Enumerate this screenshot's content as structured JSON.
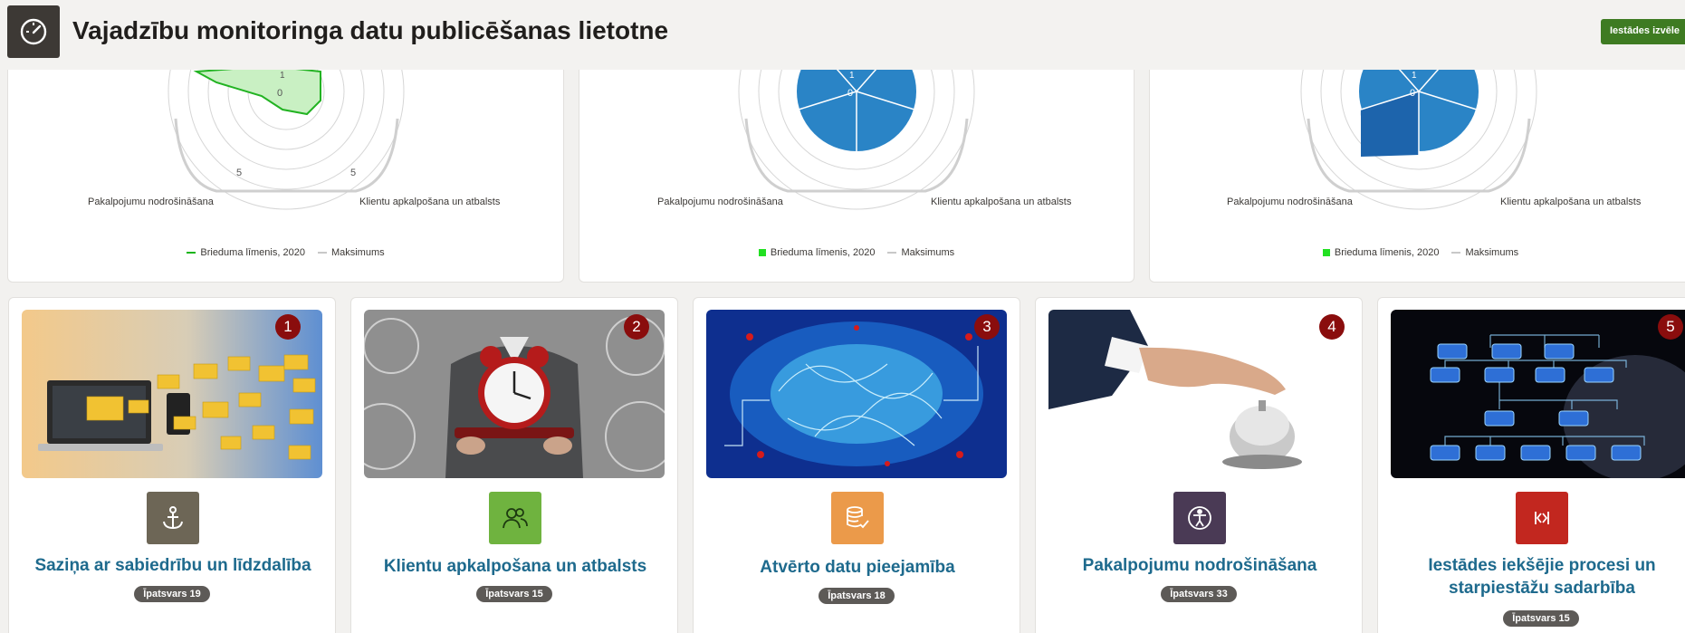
{
  "app": {
    "title": "Vajadzību monitoringa datu publicēšanas lietotne",
    "logo_icon": "dashboard-gauge-icon",
    "institution_button": "Iestādes izvēle"
  },
  "charts": [
    {
      "axis_left_label": "Pakalpojumu nodrošināšana",
      "axis_right_label": "Klientu apkalpošana un atbalsts",
      "tick_labels": [
        "1",
        "0",
        "5",
        "5"
      ],
      "legend": [
        {
          "label": "Brieduma līmenis, 2020",
          "color": "#1cb51c",
          "marker": "line"
        },
        {
          "label": "Maksimums",
          "color": "#c8c8c8",
          "marker": "line"
        }
      ]
    },
    {
      "axis_left_label": "Pakalpojumu nodrošināšana",
      "axis_right_label": "Klientu apkalpošana un atbalsts",
      "tick_labels": [
        "1",
        "0"
      ],
      "legend": [
        {
          "label": "Brieduma līmenis, 2020",
          "color": "#22e022",
          "marker": "box"
        },
        {
          "label": "Maksimums",
          "color": "#c8c8c8",
          "marker": "line"
        }
      ]
    },
    {
      "axis_left_label": "Pakalpojumu nodrošināšana",
      "axis_right_label": "Klientu apkalpošana un atbalsts",
      "tick_labels": [
        "1",
        "0"
      ],
      "legend": [
        {
          "label": "Brieduma līmenis, 2020",
          "color": "#22e022",
          "marker": "box"
        },
        {
          "label": "Maksimums",
          "color": "#c8c8c8",
          "marker": "line"
        }
      ]
    }
  ],
  "tiles": [
    {
      "number": "1",
      "title": "Saziņa ar sabiedrību un līdzdalība",
      "weight": "Īpatsvars 19",
      "icon": "anchor-icon",
      "icon_color": "#6d6656"
    },
    {
      "number": "2",
      "title": "Klientu apkalpošana un atbalsts",
      "weight": "Īpatsvars 15",
      "icon": "users-icon",
      "icon_color": "#6fb33f"
    },
    {
      "number": "3",
      "title": "Atvērto datu pieejamība",
      "weight": "Īpatsvars 18",
      "icon": "database-check-icon",
      "icon_color": "#eb9a4a"
    },
    {
      "number": "4",
      "title": "Pakalpojumu nodrošināšana",
      "weight": "Īpatsvars 33",
      "icon": "accessibility-icon",
      "icon_color": "#4a3a55"
    },
    {
      "number": "5",
      "title": "Iestādes iekšējie procesi un starpiestāžu sadarbība",
      "weight": "Īpatsvars 15",
      "icon": "code-brackets-icon",
      "icon_color": "#c2271f"
    }
  ]
}
